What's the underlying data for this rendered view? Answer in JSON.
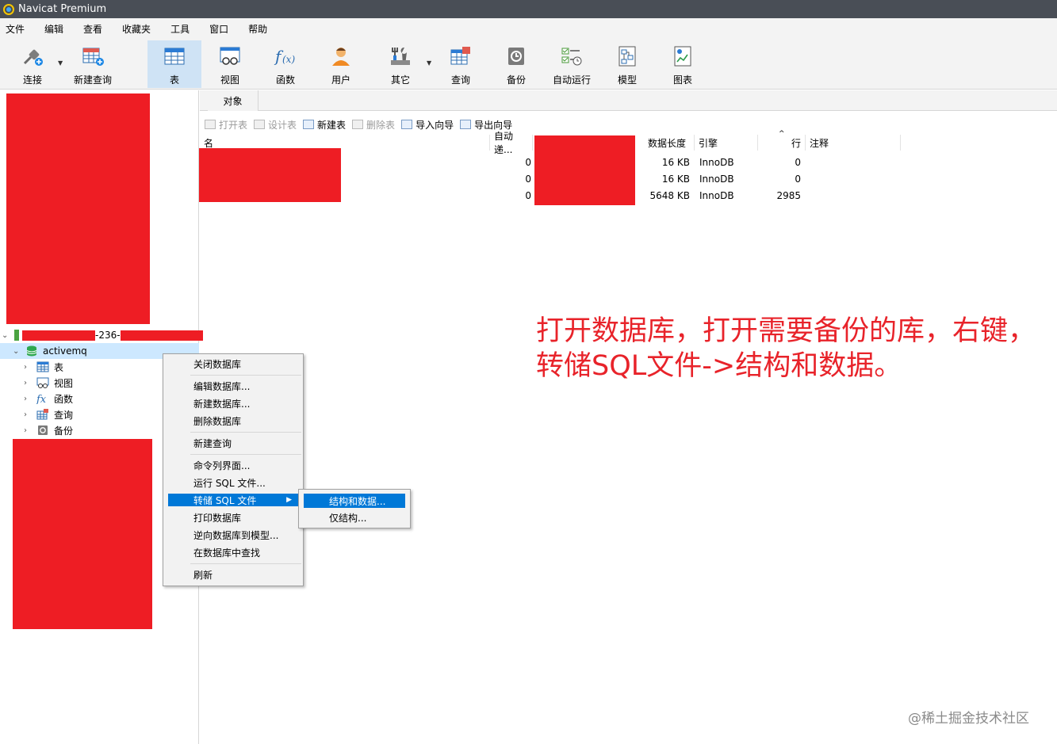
{
  "app": {
    "title": "Navicat Premium"
  },
  "menu": [
    "文件",
    "编辑",
    "查看",
    "收藏夹",
    "工具",
    "窗口",
    "帮助"
  ],
  "toolbar": {
    "connect": "连接",
    "new_query": "新建查询",
    "table": "表",
    "view": "视图",
    "function": "函数",
    "user": "用户",
    "other": "其它",
    "query": "查询",
    "backup": "备份",
    "auto_run": "自动运行",
    "model": "模型",
    "chart": "图表"
  },
  "tab": {
    "objects": "对象"
  },
  "object_toolbar": {
    "open_table": "打开表",
    "design_table": "设计表",
    "new_table": "新建表",
    "delete_table": "删除表",
    "import_wizard": "导入向导",
    "export_wizard": "导出向导"
  },
  "grid": {
    "headers": {
      "name": "名",
      "auto_inc": "自动递...",
      "data_length": "数据长度",
      "engine": "引擎",
      "rows": "行",
      "comment": "注释"
    },
    "rows": [
      {
        "auto_inc": "0",
        "data_length": "16 KB",
        "engine": "InnoDB",
        "rows": "0"
      },
      {
        "auto_inc": "0",
        "data_length": "16 KB",
        "engine": "InnoDB",
        "rows": "0"
      },
      {
        "auto_inc": "0",
        "data_length": "5648 KB",
        "engine": "InnoDB",
        "rows": "2985"
      }
    ]
  },
  "tree": {
    "connection_fragment": "-236-",
    "database": "activemq",
    "children": [
      "表",
      "视图",
      "函数",
      "查询",
      "备份"
    ]
  },
  "context_menu": {
    "close_db": "关闭数据库",
    "edit_db": "编辑数据库...",
    "new_db": "新建数据库...",
    "delete_db": "删除数据库",
    "new_query": "新建查询",
    "console": "命令列界面...",
    "run_sql": "运行 SQL 文件...",
    "dump_sql": "转储 SQL 文件",
    "print_db": "打印数据库",
    "reverse": "逆向数据库到模型...",
    "find_in_db": "在数据库中查找",
    "refresh": "刷新"
  },
  "submenu": {
    "struct_data": "结构和数据...",
    "struct_only": "仅结构..."
  },
  "annotation": {
    "line1": "打开数据库，打开需要备份的库，右键，",
    "line2": "转储SQL文件->结构和数据。"
  },
  "watermark": "@稀土掘金技术社区",
  "colors": {
    "redaction": "#ee1d24",
    "annotation": "#e8232a",
    "highlight": "#0078d7"
  }
}
